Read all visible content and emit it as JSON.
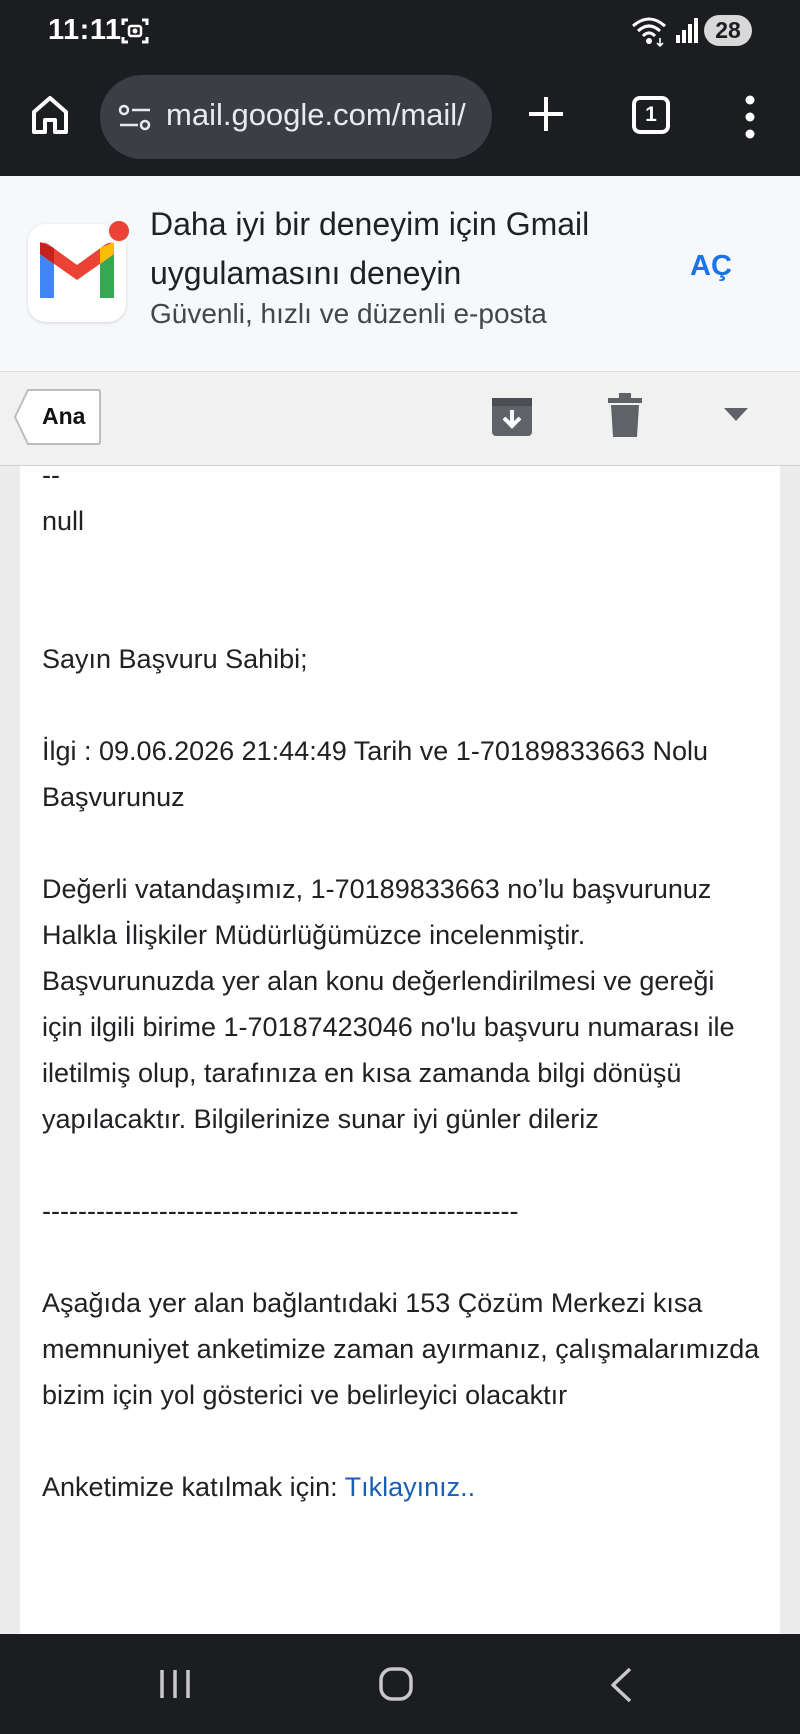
{
  "status_bar": {
    "time": "11:11",
    "battery": "28"
  },
  "browser": {
    "url": "mail.google.com/mail/",
    "tab_count": "1"
  },
  "promo": {
    "title": "Daha iyi bir deneyim için Gmail uygulamasını deneyin",
    "subtitle": "Güvenli, hızlı ve düzenli e-posta",
    "open_label": "AÇ"
  },
  "action_bar": {
    "back_label": "Ana"
  },
  "email": {
    "separator_top": "--",
    "null_text": "null",
    "greeting": "Sayın Başvuru Sahibi;",
    "reference": "İlgi : 09.06.2026 21:44:49 Tarih ve 1-70189833663 Nolu Başvurunuz",
    "body": "Değerli vatandaşımız, 1-70189833663 no’lu başvurunuz Halkla İlişkiler Müdürlüğümüzce incelenmiştir. Başvurunuzda yer alan konu değerlendirilmesi ve gereği için ilgili birime 1-70187423046 no'lu başvuru numarası ile iletilmiş olup, tarafınıza en kısa zamanda bilgi dönüşü yapılacaktır. Bilgilerinize sunar iyi günler dileriz",
    "divider": "-----------------------------------------------------",
    "survey_text": "Aşağıda yer alan bağlantıdaki 153 Çözüm Merkezi kısa memnuniyet anketimize zaman ayırmanız, çalışmalarımızda bizim için yol gösterici ve belirleyici olacaktır",
    "survey_prompt": "Anketimize katılmak için: ",
    "survey_link": "Tıklayınız.."
  },
  "colors": {
    "accent": "#1a73e8",
    "link": "#1a5fb4",
    "chrome_dark": "#1b1d21"
  },
  "icons": [
    "screen-record-icon",
    "wifi-icon",
    "signal-icon",
    "home-icon",
    "site-settings-icon",
    "new-tab-icon",
    "tab-switcher-icon",
    "overflow-menu-icon",
    "gmail-logo",
    "archive-icon",
    "trash-icon",
    "more-dropdown-icon",
    "nav-recents-icon",
    "nav-home-icon",
    "nav-back-icon"
  ]
}
